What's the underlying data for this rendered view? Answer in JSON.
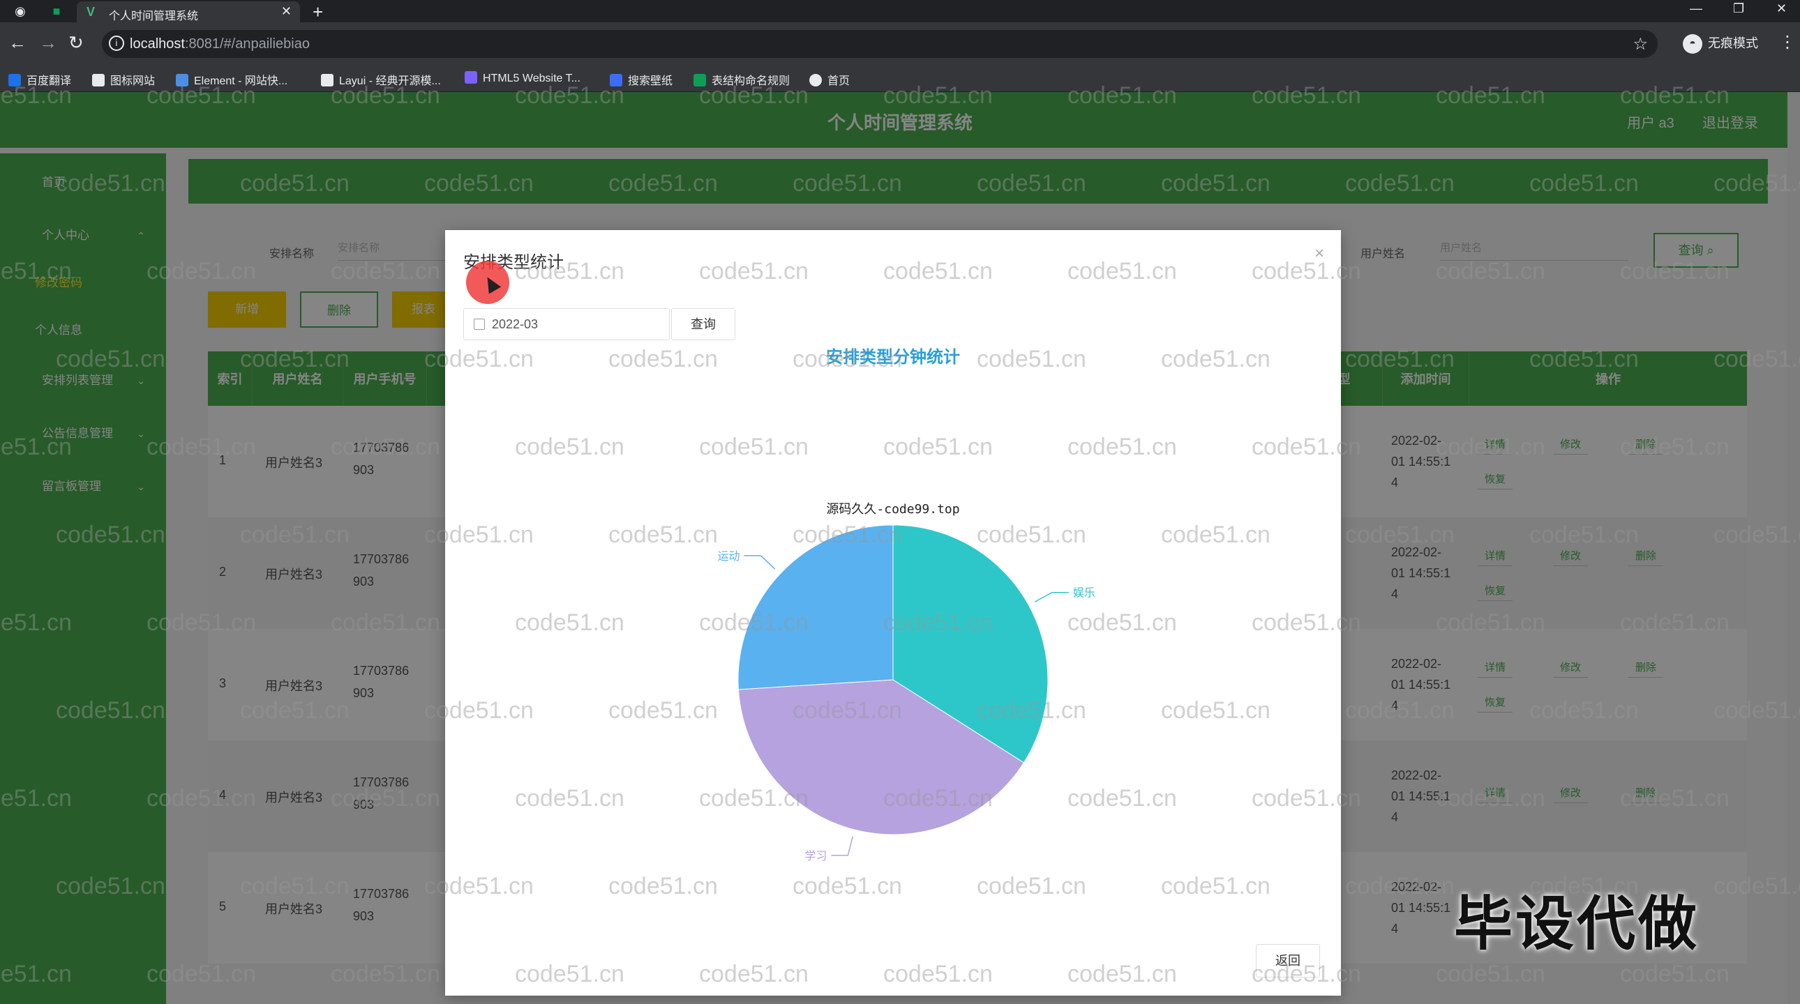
{
  "browser": {
    "tab_title": "个人时间管理系统",
    "url_host": "localhost",
    "url_rest": ":8081/#/anpailiebiao",
    "incognito_label": "无痕模式",
    "bookmarks": [
      "百度翻译",
      "图标网站",
      "Element - 网站快...",
      "Layui - 经典开源模...",
      "HTML5 Website T...",
      "搜索壁纸",
      "表结构命名规则",
      "首页"
    ],
    "bookmark_colors": [
      "#1a73e8",
      "#e8eaed",
      "#4a90e2",
      "#e8eaed",
      "#7b61ff",
      "#3b6ef5",
      "#0f9d58",
      "#e8eaed"
    ]
  },
  "app": {
    "title": "个人时间管理系统",
    "user": "用户 a3",
    "logout": "退出登录",
    "sidebar": [
      {
        "label": "首页",
        "arrow": ""
      },
      {
        "label": "个人中心",
        "arrow": "⌃"
      },
      {
        "label": "修改密码",
        "arrow": ""
      },
      {
        "label": "个人信息",
        "arrow": ""
      },
      {
        "label": "安排列表管理",
        "arrow": "⌄"
      },
      {
        "label": "公告信息管理",
        "arrow": "⌄"
      },
      {
        "label": "留言板管理",
        "arrow": "⌄"
      }
    ],
    "search": {
      "label1": "安排名称",
      "placeholder1": "安排名称",
      "label2": "用户姓名",
      "placeholder2": "用户姓名",
      "query": "查询"
    },
    "actions": [
      "新增",
      "删除",
      "报表"
    ],
    "table": {
      "headers": [
        "索引",
        "用户姓名",
        "用户手机号",
        "安排类型",
        "添加时间",
        "操作"
      ],
      "rows": [
        {
          "index": "1",
          "name": "用户姓名3",
          "phone1": "17703786",
          "phone2": "903",
          "time1": "2022-02-",
          "time2": "01 14:55:1",
          "time3": "4"
        },
        {
          "index": "2",
          "name": "用户姓名3",
          "phone1": "17703786",
          "phone2": "903",
          "time1": "2022-02-",
          "time2": "01 14:55:1",
          "time3": "4"
        },
        {
          "index": "3",
          "name": "用户姓名3",
          "phone1": "17703786",
          "phone2": "903",
          "time1": "2022-02-",
          "time2": "01 14:55:1",
          "time3": "4"
        },
        {
          "index": "4",
          "name": "用户姓名3",
          "phone1": "17703786",
          "phone2": "903",
          "time1": "2022-02-",
          "time2": "01 14:55:1",
          "time3": "4"
        },
        {
          "index": "5",
          "name": "用户姓名3",
          "phone1": "17703786",
          "phone2": "903",
          "time1": "2022-02-",
          "time2": "01 14:55:1",
          "time3": "4"
        }
      ],
      "ops": {
        "detail": "详情",
        "edit": "修改",
        "delete": "删除",
        "restore": "恢复"
      }
    }
  },
  "modal": {
    "title": "安排类型统计",
    "date_value": "2022-03",
    "query": "查询",
    "return": "返回",
    "close": "×"
  },
  "chart_data": {
    "type": "pie",
    "title": "安排类型分钟统计",
    "subtitle": "源码久久-code99.top",
    "slices": [
      {
        "name": "娱乐",
        "value": 34,
        "color": "#2ec7c9"
      },
      {
        "name": "学习",
        "value": 40,
        "color": "#b6a2de"
      },
      {
        "name": "运动",
        "value": 26,
        "color": "#5ab1ef"
      }
    ]
  },
  "watermark": {
    "text": "code51.cn",
    "big_text": "毕设代做"
  }
}
